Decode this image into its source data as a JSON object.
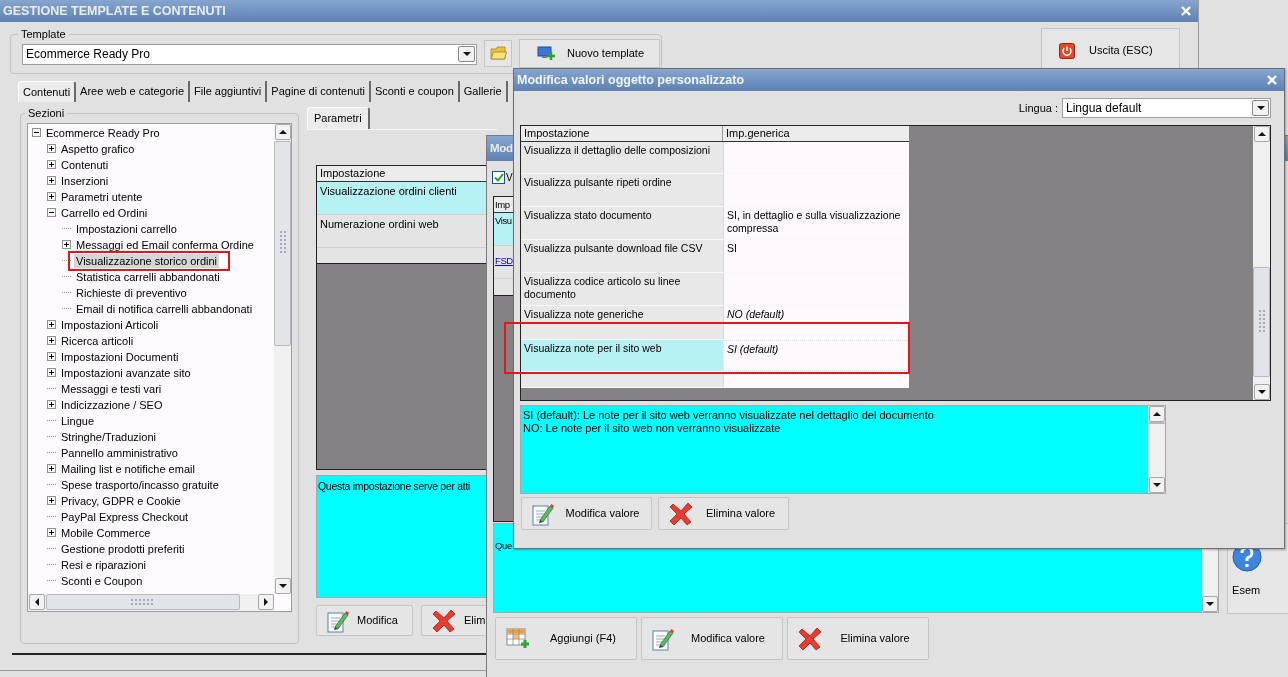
{
  "main_window": {
    "title": "GESTIONE TEMPLATE E CONTENUTI",
    "template_group": {
      "label": "Template",
      "value": "Ecommerce Ready Pro",
      "new_button": "Nuovo template"
    },
    "exit_button": "Uscita (ESC)",
    "tabs": [
      {
        "label": "Contenuti",
        "selected": true
      },
      {
        "label": "Aree web e categorie",
        "selected": false
      },
      {
        "label": "File aggiuntivi",
        "selected": false
      },
      {
        "label": "Pagine di contenuti",
        "selected": false
      },
      {
        "label": "Sconti e coupon",
        "selected": false
      },
      {
        "label": "Gallerie",
        "selected": false
      }
    ],
    "sections": {
      "label": "Sezioni",
      "tree": [
        {
          "label": "Ecommerce Ready Pro",
          "expanded": true,
          "selected": false,
          "highlighted": false,
          "children": [
            {
              "label": "Aspetto grafico",
              "expanded": false,
              "selected": false,
              "highlighted": false
            },
            {
              "label": "Contenuti",
              "expanded": false,
              "selected": false,
              "highlighted": false
            },
            {
              "label": "Inserzioni",
              "expanded": false,
              "selected": false,
              "highlighted": false
            },
            {
              "label": "Parametri utente",
              "expanded": false,
              "selected": false,
              "highlighted": false
            },
            {
              "label": "Carrello ed Ordini",
              "expanded": true,
              "selected": false,
              "highlighted": false,
              "children": [
                {
                  "label": "Impostazioni carrello",
                  "selected": false,
                  "highlighted": false
                },
                {
                  "label": "Messaggi ed Email conferma Ordine",
                  "expanded": false,
                  "selected": false,
                  "highlighted": false
                },
                {
                  "label": "Visualizzazione storico ordini",
                  "selected": true,
                  "highlighted": true
                },
                {
                  "label": "Statistica carrelli abbandonati",
                  "selected": false,
                  "highlighted": false
                },
                {
                  "label": "Richieste di preventivo",
                  "selected": false,
                  "highlighted": false
                },
                {
                  "label": "Email di notifica carrelli abbandonati",
                  "selected": false,
                  "highlighted": false
                }
              ]
            },
            {
              "label": "Impostazioni Articoli",
              "expanded": false,
              "selected": false,
              "highlighted": false
            },
            {
              "label": "Ricerca articoli",
              "expanded": false,
              "selected": false,
              "highlighted": false
            },
            {
              "label": "Impostazioni Documenti",
              "expanded": false,
              "selected": false,
              "highlighted": false
            },
            {
              "label": "Impostazioni avanzate sito",
              "expanded": false,
              "selected": false,
              "highlighted": false
            },
            {
              "label": "Messaggi e testi vari",
              "selected": false,
              "highlighted": false
            },
            {
              "label": "Indicizzazione / SEO",
              "expanded": false,
              "selected": false,
              "highlighted": false
            },
            {
              "label": "Lingue",
              "selected": false,
              "highlighted": false
            },
            {
              "label": "Stringhe/Traduzioni",
              "selected": false,
              "highlighted": false
            },
            {
              "label": "Pannello amministrativo",
              "selected": false,
              "highlighted": false
            },
            {
              "label": "Mailing list e notifiche email",
              "expanded": false,
              "selected": false,
              "highlighted": false
            },
            {
              "label": "Spese trasporto/incasso gratuite",
              "selected": false,
              "highlighted": false
            },
            {
              "label": "Privacy, GDPR e Cookie",
              "expanded": false,
              "selected": false,
              "highlighted": false
            },
            {
              "label": "PayPal Express Checkout",
              "selected": false,
              "highlighted": false
            },
            {
              "label": "Mobile Commerce",
              "expanded": false,
              "selected": false,
              "highlighted": false
            },
            {
              "label": "Gestione prodotti preferiti",
              "selected": false,
              "highlighted": false
            },
            {
              "label": "Resi e riparazioni",
              "selected": false,
              "highlighted": false
            },
            {
              "label": "Sconti e Coupon",
              "selected": false,
              "highlighted": false
            }
          ]
        }
      ]
    },
    "params": {
      "tab": "Parametri",
      "column": "Impostazione",
      "rows": [
        {
          "label": "Visualizzazione ordini clienti",
          "selected": true
        },
        {
          "label": "Numerazione ordini web",
          "selected": false
        }
      ],
      "description": "Questa impostazione serve per atti",
      "buttons": [
        {
          "kind": "edit",
          "label": "Modifica"
        },
        {
          "kind": "delete",
          "label": "Elim"
        }
      ]
    }
  },
  "back_dialog": {
    "title": "Mod",
    "checkbox": {
      "label": "V",
      "checked": true
    },
    "column": "Imp",
    "rows": [
      {
        "kind": "text",
        "label": "Visu",
        "selected": true
      },
      {
        "kind": "link",
        "label": "FSD",
        "selected": false
      }
    ],
    "description": "Que",
    "side_button": "Esem",
    "buttons": [
      {
        "kind": "add",
        "label": "Aggiungi (F4)"
      },
      {
        "kind": "edit",
        "label": "Modifica valore"
      },
      {
        "kind": "delete",
        "label": "Elimina valore"
      }
    ]
  },
  "front_dialog": {
    "title": "Modifica valori oggetto personalizzato",
    "language": {
      "label": "Lingua :",
      "value": "Lingua default"
    },
    "columns": [
      "Impostazione",
      "Imp.generica"
    ],
    "rows": [
      {
        "kind": "setting",
        "setting": "Visualizza il dettaglio delle composizioni",
        "selected": false,
        "highlighted": false
      },
      {
        "kind": "setting",
        "setting": "Visualizza pulsante ripeti ordine",
        "selected": false,
        "highlighted": false
      },
      {
        "kind": "setting",
        "setting": "Visualizza stato documento",
        "value": "SI, in dettaglio e sulla visualizzazione compressa",
        "italic": false,
        "selected": false,
        "highlighted": false
      },
      {
        "kind": "setting",
        "setting": "Visualizza pulsante download file CSV",
        "value": "SI",
        "italic": false,
        "selected": false,
        "highlighted": false
      },
      {
        "kind": "setting",
        "setting": "Visualizza codice articolo su linee documento",
        "selected": false,
        "highlighted": false
      },
      {
        "kind": "setting",
        "setting": "Visualizza note generiche",
        "value": "NO (default)",
        "italic": true,
        "selected": false,
        "highlighted": false
      },
      {
        "kind": "blank",
        "selected": false,
        "highlighted": true
      },
      {
        "kind": "setting",
        "setting": "Visualizza note per il sito web",
        "value": "SI (default)",
        "italic": true,
        "selected": true,
        "highlighted": true
      },
      {
        "kind": "blank",
        "selected": false,
        "highlighted": false
      }
    ],
    "description": [
      "SI (default): Le note per il sito web verranno visualizzate nel dettaglio del documento",
      "NO: Le note per il sito web non verranno visualizzate"
    ],
    "buttons": [
      {
        "kind": "edit",
        "label": "Modifica valore"
      },
      {
        "kind": "delete",
        "label": "Elimina valore"
      }
    ]
  }
}
